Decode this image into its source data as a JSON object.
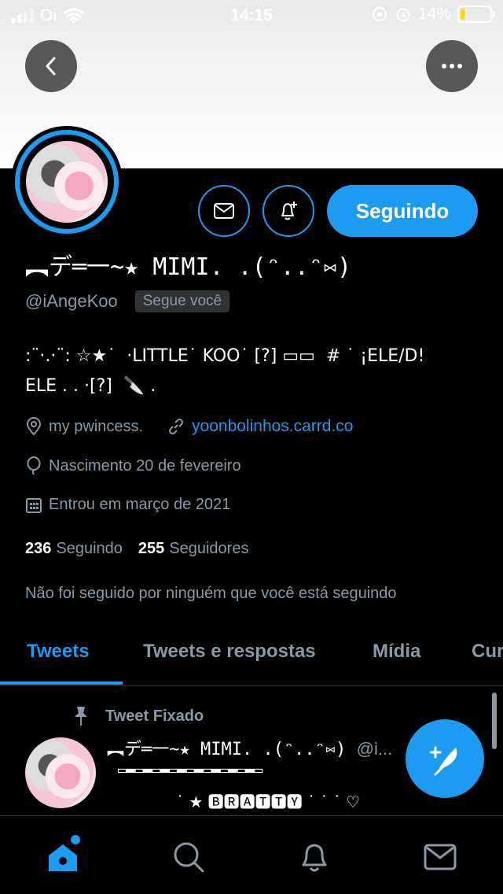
{
  "status_bar": {
    "carrier": "Oi",
    "time": "14:15",
    "battery": "14%",
    "battery_level": 0.14
  },
  "profile": {
    "display_name": "︻デ═一~★ MIMI. .(ᵔ..ᵔ⑅)",
    "handle": "@iAngeKoo",
    "follows_you_badge": "Segue você",
    "following_button": "Seguindo",
    "bio_line1": ":¨·.·¨: ☆★˙  ·LITTLE˙ KOO˙ [?] ▭▭  # ˙ ¡ELE/D!",
    "bio_line2": "ELE . . ·[?]  🔪 .",
    "location": "my pwincess.",
    "link": "yoonbolinhos.carrd.co",
    "birthday": "Nascimento 20 de fevereiro",
    "joined": "Entrou em março de 2021",
    "following_count": "236",
    "following_label": "Seguindo",
    "followers_count": "255",
    "followers_label": "Seguidores",
    "not_followed_text": "Não foi seguido por ninguém que você está seguindo"
  },
  "tabs": [
    {
      "label": "Tweets",
      "active": true
    },
    {
      "label": "Tweets e respostas",
      "active": false
    },
    {
      "label": "Mídia",
      "active": false
    },
    {
      "label": "Cur",
      "active": false
    }
  ],
  "pinned_tweet": {
    "pinned_label": "Tweet Fixado",
    "author_name": "︻デ═一~★ MIMI. .(ᵔ..ᵔ⑅)",
    "author_handle": "@i...",
    "line1": "▭▬▭▬▭▬▭▬▭▬▭▬▭▬▭▬▭",
    "line2": "˙  ★  🅱🆁🅰🆃🆃🆈 ˙     ˙  ˙  ♡"
  },
  "colors": {
    "accent": "#1d9bf0",
    "background": "#000000",
    "secondary_text": "#8b98a5"
  },
  "icons": {
    "back": "chevron-left-icon",
    "more": "more-horizontal-icon",
    "message": "envelope-icon",
    "notify": "bell-plus-icon",
    "location": "map-pin-icon",
    "link": "link-icon",
    "birthday": "balloon-icon",
    "joined": "calendar-icon",
    "pinned": "pin-icon",
    "compose": "compose-feather-icon",
    "nav": [
      "home-icon",
      "search-icon",
      "bell-icon",
      "mail-icon"
    ]
  }
}
